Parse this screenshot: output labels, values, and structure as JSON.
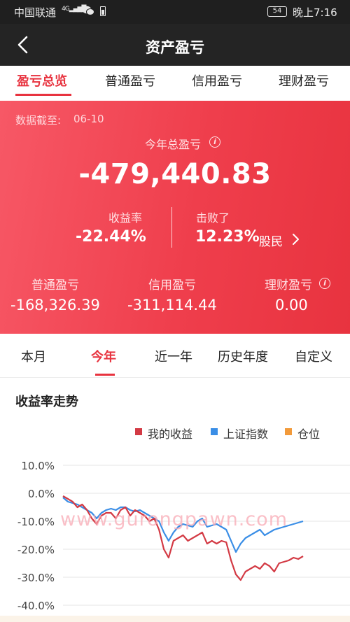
{
  "status_bar": {
    "carrier": "中国联通",
    "signal": "4G",
    "battery": "54",
    "time": "晚上7:16"
  },
  "nav": {
    "title": "资产盈亏",
    "back_icon": "chevron-left-icon"
  },
  "top_tabs": [
    "盈亏总览",
    "普通盈亏",
    "信用盈亏",
    "理财盈亏"
  ],
  "summary": {
    "as_of_label": "数据截至:",
    "as_of_date": "06-10",
    "total_label": "今年总盈亏",
    "total_value": "-479,440.83",
    "rate_label": "收益率",
    "rate_value": "-22.44%",
    "beat_label": "击败了",
    "beat_value": "12.23%",
    "beat_unit": "股民",
    "ordinary_label": "普通盈亏",
    "ordinary_value": "-168,326.39",
    "credit_label": "信用盈亏",
    "credit_value": "-311,114.44",
    "wealth_label": "理财盈亏",
    "wealth_value": "0.00",
    "colors": {
      "gradient_start": "#f75866",
      "gradient_end": "#e8333f"
    }
  },
  "period_tabs": [
    "本月",
    "今年",
    "近一年",
    "历史年度",
    "自定义"
  ],
  "chart_section": {
    "title": "收益率走势",
    "watermark": "www.gurongpawn.com"
  },
  "chart_data": {
    "type": "line",
    "ylim": [
      -40,
      10
    ],
    "yticks": [
      "10.0%",
      "0.0%",
      "-10.0%",
      "-20.0%",
      "-30.0%",
      "-40.0%"
    ],
    "ytick_values": [
      10,
      0,
      -10,
      -20,
      -30,
      -40
    ],
    "grid": true,
    "legend_position": "top-right",
    "legend": [
      {
        "name": "我的收益",
        "color": "#d33a44"
      },
      {
        "name": "上证指数",
        "color": "#3a8ee6"
      },
      {
        "name": "仓位",
        "color": "#f29a3a"
      }
    ],
    "series": [
      {
        "name": "我的收益",
        "color": "#d33a44",
        "values": [
          -1,
          -2,
          -3,
          -5,
          -4,
          -6,
          -9,
          -11,
          -8,
          -7,
          -7,
          -9,
          -6,
          -5,
          -8,
          -6,
          -7,
          -8,
          -10,
          -9,
          -13,
          -20,
          -23,
          -17,
          -16,
          -15,
          -17,
          -16,
          -15,
          -14,
          -18,
          -17,
          -18,
          -17,
          -17.5,
          -24,
          -29,
          -31,
          -28,
          -27,
          -26,
          -27,
          -25,
          -26,
          -28,
          -25,
          -24.5,
          -24,
          -23,
          -23.5,
          -22.5
        ]
      },
      {
        "name": "上证指数",
        "color": "#3a8ee6",
        "values": [
          -1.5,
          -3,
          -3.5,
          -4,
          -5,
          -6,
          -7,
          -9,
          -7,
          -6,
          -5.5,
          -6,
          -5,
          -5,
          -6,
          -6.5,
          -6,
          -7,
          -8,
          -9,
          -10,
          -14,
          -17,
          -14,
          -12,
          -11,
          -11.5,
          -12,
          -10,
          -9,
          -12,
          -11.5,
          -11,
          -12,
          -13,
          -17,
          -21,
          -18,
          -16,
          -15,
          -14,
          -13,
          -15,
          -14,
          -13,
          -12.5,
          -12,
          -11.5,
          -11,
          -10.5,
          -10
        ]
      }
    ]
  }
}
